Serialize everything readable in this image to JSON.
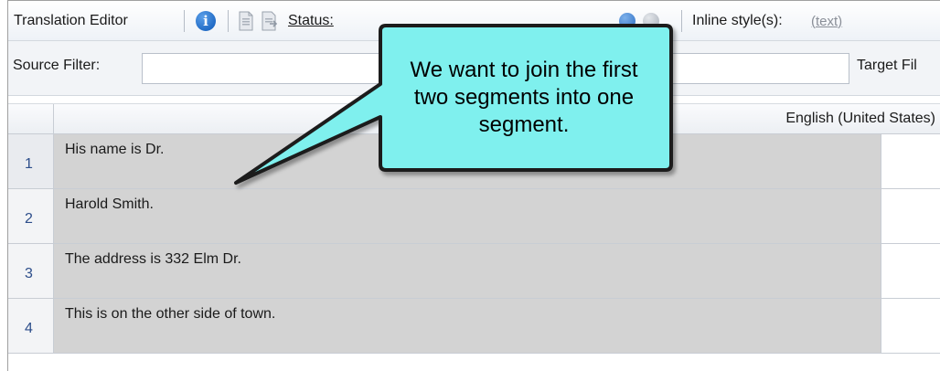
{
  "toolbar": {
    "title": "Translation Editor",
    "status_label": "Status:",
    "inline_label": "Inline style(s):",
    "inline_value": "(text)"
  },
  "filters": {
    "source_label": "Source Filter:",
    "source_value": "",
    "target_label": "Target Fil",
    "target_value": ""
  },
  "grid": {
    "source_column_header": "English (United States)",
    "rows": [
      {
        "number": "1",
        "source": "His name is Dr.",
        "target": ""
      },
      {
        "number": "2",
        "source": "Harold Smith.",
        "target": ""
      },
      {
        "number": "3",
        "source": "The address is 332 Elm Dr.",
        "target": ""
      },
      {
        "number": "4",
        "source": "This is on the other side of town.",
        "target": ""
      }
    ]
  },
  "callout": {
    "text": "We want to join the first two segments into one segment.",
    "fill_color": "#7ff0ee",
    "border_color": "#1a1a1a"
  },
  "colors": {
    "source_cell_bg": "#d3d3d3",
    "row_number_color": "#2c4d8a",
    "info_icon_color": "#0b58b8"
  },
  "icons": [
    "info-icon",
    "document-icon",
    "document-arrow-icon"
  ]
}
